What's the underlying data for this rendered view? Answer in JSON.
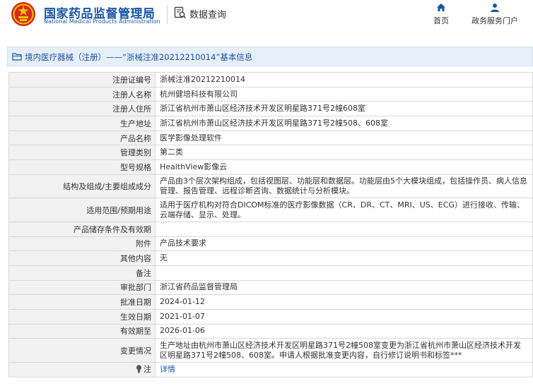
{
  "header": {
    "org_name_cn": "国家药品监督管理局",
    "org_name_en": "National Medical Products Administration",
    "query_label": "数据查询",
    "nav": [
      {
        "label": "首页",
        "icon": "home-icon"
      },
      {
        "label": "政务服务门户",
        "icon": "user-icon"
      }
    ]
  },
  "breadcrumb": {
    "text": "境内医疗器械（注册）——“浙械注准20212210014”基本信息"
  },
  "details": [
    {
      "key": "注册证编号",
      "value": "浙械注准20212210014"
    },
    {
      "key": "注册人名称",
      "value": "杭州健培科技有限公司"
    },
    {
      "key": "注册人住所",
      "value": "浙江省杭州市萧山区经济技术开发区明星路371号2幢608室"
    },
    {
      "key": "生产地址",
      "value": "浙江省杭州市萧山区经济技术开发区明星路371号2幢508、608室"
    },
    {
      "key": "产品名称",
      "value": "医学影像处理软件"
    },
    {
      "key": "管理类别",
      "value": "第二类"
    },
    {
      "key": "型号规格",
      "value": "HealthView影像云"
    },
    {
      "key": "结构及组成/主要组成成分",
      "value": "产品由3个层次架构组成，包括视图层、功能层和数据层。功能层由5个大模块组成，包括操作员、病人信息管理、报告管理、远程诊断咨询、数据统计与分析模块。"
    },
    {
      "key": "适用范围/预期用途",
      "value": "适用于医疗机构对符合DICOM标准的医疗影像数据（CR、DR、CT、MRI、US、ECG）进行接收、传输、云端存储、显示、处理。"
    },
    {
      "key": "产品储存条件及有效期",
      "value": ""
    },
    {
      "key": "附件",
      "value": "产品技术要求"
    },
    {
      "key": "其他内容",
      "value": "无"
    },
    {
      "key": "备注",
      "value": ""
    },
    {
      "key": "审批部门",
      "value": "浙江省药品监督管理局"
    },
    {
      "key": "批准日期",
      "value": "2024-01-12"
    },
    {
      "key": "生效日期",
      "value": "2021-01-07"
    },
    {
      "key": "有效期至",
      "value": "2026-01-06"
    },
    {
      "key": "变更情况",
      "value": "生产地址由杭州市萧山区经济技术开发区明星路371号2幢508室变更为浙江省杭州市萧山区经济技术开发区明星路371号2幢508、608室。申请人根据批准变更内容，自行修订说明书和标签***"
    }
  ],
  "note": {
    "key": "注",
    "link_text": "详情"
  },
  "colors": {
    "brand_blue": "#1a55a5",
    "emblem_red": "#d7281f",
    "emblem_gold": "#f2c200"
  }
}
